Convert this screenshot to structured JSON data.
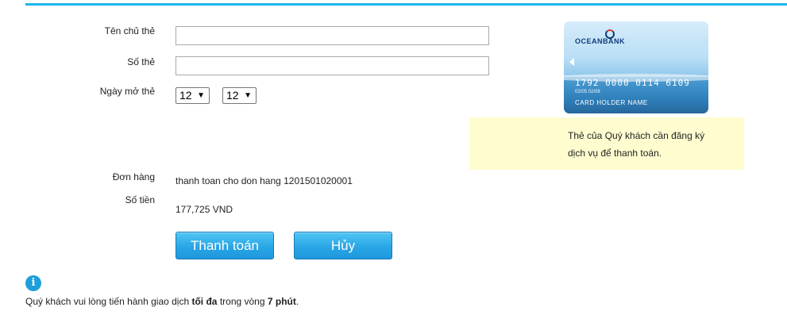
{
  "form": {
    "cardholder_label": "Tên chủ thẻ",
    "cardholder_value": "",
    "cardnumber_label": "Số thẻ",
    "cardnumber_value": "",
    "open_date_label": "Ngày mở thẻ",
    "open_month": "12",
    "open_year": "12"
  },
  "order": {
    "order_label": "Đơn hàng",
    "order_value": "thanh toan cho don hang 1201501020001",
    "amount_label": "Số tiền",
    "amount_value": "177,725 VND"
  },
  "buttons": {
    "pay_label": "Thanh toán",
    "cancel_label": "Hủy"
  },
  "card": {
    "bank_name": "OCEANBANK",
    "number": "1792 0000 0114 6109",
    "valid_text": "02/05   02/08",
    "holder": "CARD HOLDER NAME"
  },
  "note": {
    "line1": "Thẻ của Quý khách cần đăng ký",
    "line2": "dịch vụ để thanh toán."
  },
  "footer": {
    "prefix": "Quý khách vui lòng tiến hành giao dịch ",
    "bold1": "tối đa",
    "middle": " trong vòng ",
    "bold2": "7 phút",
    "suffix": "."
  },
  "icons": {
    "info": "info-icon",
    "dropdown": "chevron-down-icon"
  },
  "colors": {
    "accent_line": "#1fb4e8",
    "button": "#29a6e6",
    "note_bg": "#fffdd0",
    "info_icon": "#1e9fd8"
  }
}
